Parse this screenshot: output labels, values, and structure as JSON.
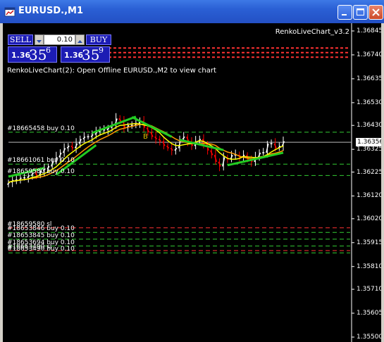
{
  "window": {
    "title": "EURUSD.,M1"
  },
  "trade_panel": {
    "sell_label": "SELL",
    "buy_label": "BUY",
    "lot_value": "0.10",
    "sell_price": {
      "prefix": "1.36",
      "big": "35",
      "sup": "6"
    },
    "buy_price": {
      "prefix": "1.36",
      "big": "35",
      "sup": "9"
    }
  },
  "indicator_name": "RenkoLiveChart_v3.2",
  "message": "RenkoLiveChart(2): Open Offline EURUSD.,M2 to view chart",
  "current_price": "1.36356",
  "marker_letter": "B",
  "order_labels": [
    "#18665458 buy 0.10",
    "#18661061 buy 0.10",
    "#18659580 buy 0.10",
    "#18659580 sl",
    "#18653846 buy 0.10",
    "#18653845 buy 0.10",
    "#18653694 buy 0.10",
    "#18653490 sl",
    "#18653490 buy 0.10"
  ],
  "price_axis": [
    "1.36845",
    "1.36740",
    "1.36635",
    "1.36530",
    "1.36430",
    "1.36325",
    "1.36225",
    "1.36120",
    "1.36020",
    "1.35915",
    "1.35810",
    "1.35710",
    "1.35605",
    "1.35500"
  ],
  "colors": {
    "background": "#000000",
    "bull_candle": "#ffffff",
    "bear_candle": "#ff0000",
    "ma_fast": "#ffff00",
    "ma_slow": "#ff9900",
    "renko_bricks": "#22cc22",
    "order_line": "#33cc33",
    "stoploss_line": "#ff3333",
    "title_bar": "#2a5fd4"
  },
  "chart_data": {
    "type": "candlestick",
    "symbol": "EURUSD.",
    "timeframe": "M1",
    "ylim": [
      1.355,
      1.369
    ],
    "close_series": [
      1.3618,
      1.3619,
      1.3619,
      1.362,
      1.362,
      1.3621,
      1.3622,
      1.3621,
      1.3623,
      1.3624,
      1.3625,
      1.3627,
      1.3629,
      1.3631,
      1.3633,
      1.3634,
      1.3633,
      1.3635,
      1.3637,
      1.3638,
      1.3638,
      1.3639,
      1.364,
      1.3641,
      1.3641,
      1.3642,
      1.3643,
      1.3646,
      1.3645,
      1.3642,
      1.3643,
      1.3643,
      1.3644,
      1.3645,
      1.3642,
      1.364,
      1.3638,
      1.3637,
      1.3636,
      1.3634,
      1.3633,
      1.3632,
      1.3633,
      1.3637,
      1.3638,
      1.3636,
      1.3634,
      1.3636,
      1.3637,
      1.3635,
      1.3632,
      1.363,
      1.3627,
      1.3625,
      1.3629,
      1.3628,
      1.363,
      1.363,
      1.3629,
      1.363,
      1.3628,
      1.3627,
      1.3629,
      1.3631,
      1.3631,
      1.3635,
      1.3635,
      1.3633,
      1.3634,
      1.3636
    ],
    "order_levels": [
      {
        "price": 1.364,
        "kind": "buy"
      },
      {
        "price": 1.3626,
        "kind": "buy"
      },
      {
        "price": 1.3621,
        "kind": "buy"
      },
      {
        "price": 1.3598,
        "kind": "sl"
      },
      {
        "price": 1.3596,
        "kind": "buy"
      },
      {
        "price": 1.3593,
        "kind": "buy"
      },
      {
        "price": 1.359,
        "kind": "buy"
      },
      {
        "price": 1.3588,
        "kind": "sl"
      },
      {
        "price": 1.3587,
        "kind": "buy"
      }
    ],
    "red_levels": [
      1.3677,
      1.3675,
      1.3673
    ]
  }
}
